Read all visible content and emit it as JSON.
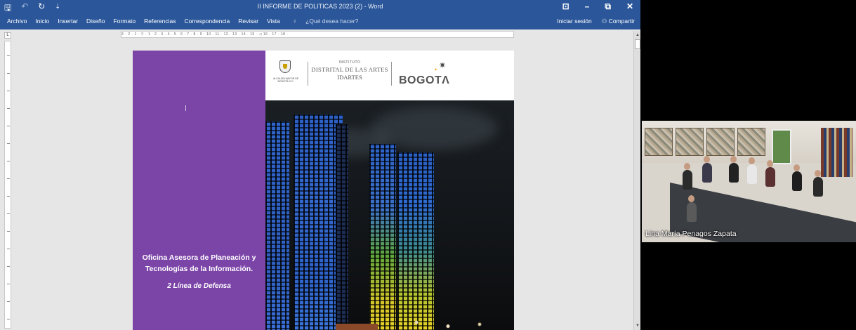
{
  "titlebar": {
    "save_glyph": "🖫",
    "undo_glyph": "↶",
    "redo_glyph": "↻",
    "customize_glyph": "⇣",
    "document_title": "II INFORME DE POLITICAS 2023 (2) - Word",
    "options_glyph": "⊡",
    "minimize_glyph": "–",
    "restore_glyph": "⧉",
    "close_glyph": "✕"
  },
  "ribbon": {
    "tabs": [
      "Archivo",
      "Inicio",
      "Insertar",
      "Diseño",
      "Formato",
      "Referencias",
      "Correspondencia",
      "Revisar",
      "Vista"
    ],
    "tell_me": "¿Qué desea hacer?",
    "sign_in": "Iniciar sesión",
    "share": "Compartir"
  },
  "ruler": {
    "corner": "L",
    "marks": "3 · 2 · 1 · ▽ · 1 · 2 · 3 · 4 · 5 · 6 · 7 · 8 · 9 · 10 · 11 · 12 · 13 · 14 · 15 · ◁ 16 · 17 · 18 ·"
  },
  "document": {
    "logo": {
      "alcaldia": "ALCALDÍA MAYOR DE BOGOTÁ D.C.",
      "instituto_line1": "INSTITUTO",
      "instituto_line2": "DISTRITAL DE LAS ARTES",
      "instituto_line3": "IDARTES",
      "city": "BOGOTΛ"
    },
    "office_title": "Oficina Asesora de Planeación y Tecnologías de la Información.",
    "subtitle": "2 Línea de Defensa",
    "colors": {
      "purple_panel": "#7b45a8"
    }
  },
  "video": {
    "participant_name": "Lina María Penagos Zapata"
  },
  "colors": {
    "word_blue": "#2b579a"
  }
}
